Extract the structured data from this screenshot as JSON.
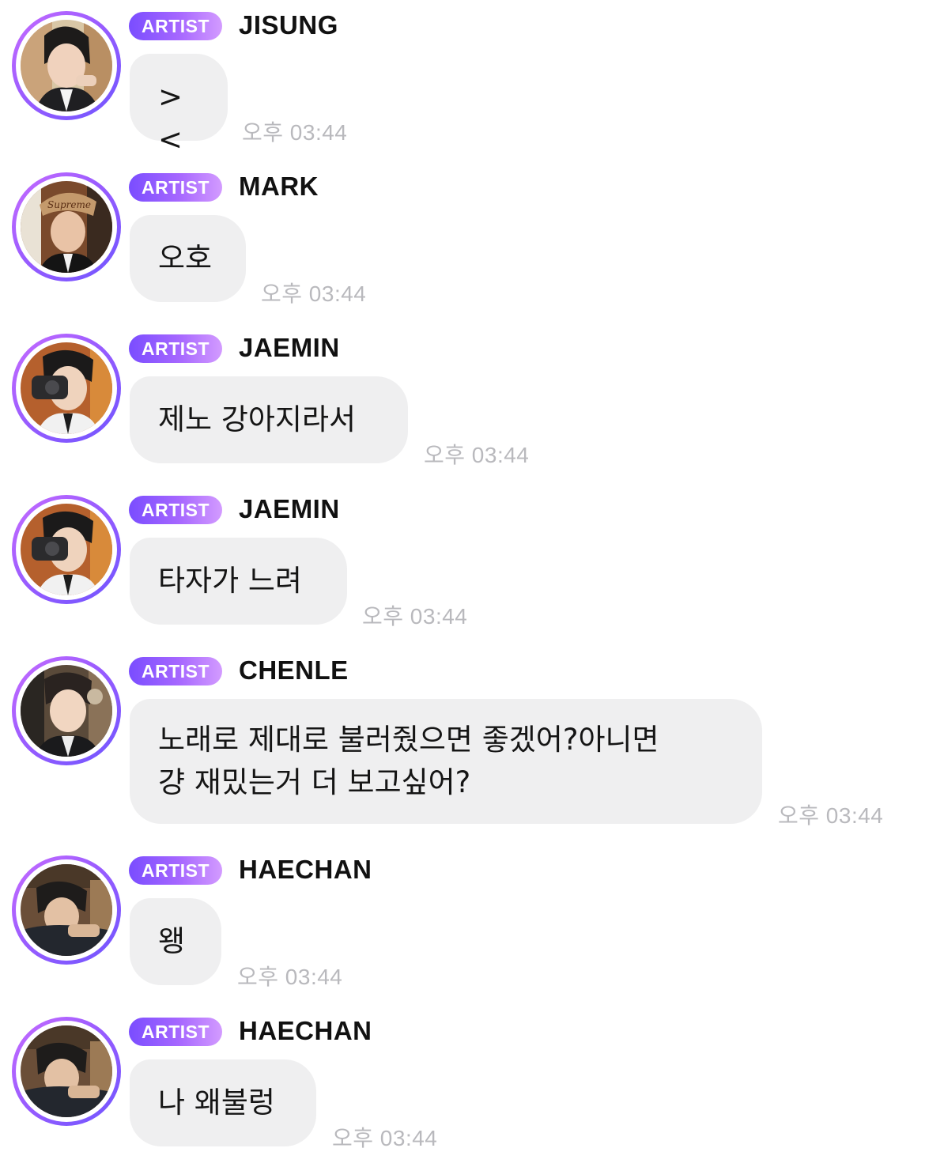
{
  "badge_color_start": "#7a4dff",
  "badge_color_end": "#d39bff",
  "bubble_color": "#efeff0",
  "messages": [
    {
      "badge": "ARTIST",
      "name": "JISUNG",
      "text": "><",
      "time": "오후 03:44",
      "avatar": "jisung-avatar"
    },
    {
      "badge": "ARTIST",
      "name": "MARK",
      "text": "오호",
      "time": "오후 03:44",
      "avatar": "mark-avatar"
    },
    {
      "badge": "ARTIST",
      "name": "JAEMIN",
      "text": "제노 강아지라서",
      "time": "오후 03:44",
      "avatar": "jaemin-avatar"
    },
    {
      "badge": "ARTIST",
      "name": "JAEMIN",
      "text": "타자가 느려",
      "time": "오후 03:44",
      "avatar": "jaemin-avatar"
    },
    {
      "badge": "ARTIST",
      "name": "CHENLE",
      "text": "노래로 제대로 불러줬으면 좋겠어?아니면\n걍 재밌는거 더 보고싶어?",
      "time": "오후 03:44",
      "avatar": "chenle-avatar"
    },
    {
      "badge": "ARTIST",
      "name": "HAECHAN",
      "text": "왱",
      "time": "오후 03:44",
      "avatar": "haechan-avatar"
    },
    {
      "badge": "ARTIST",
      "name": "HAECHAN",
      "text": "나 왜불렁",
      "time": "오후 03:44",
      "avatar": "haechan-avatar"
    }
  ]
}
